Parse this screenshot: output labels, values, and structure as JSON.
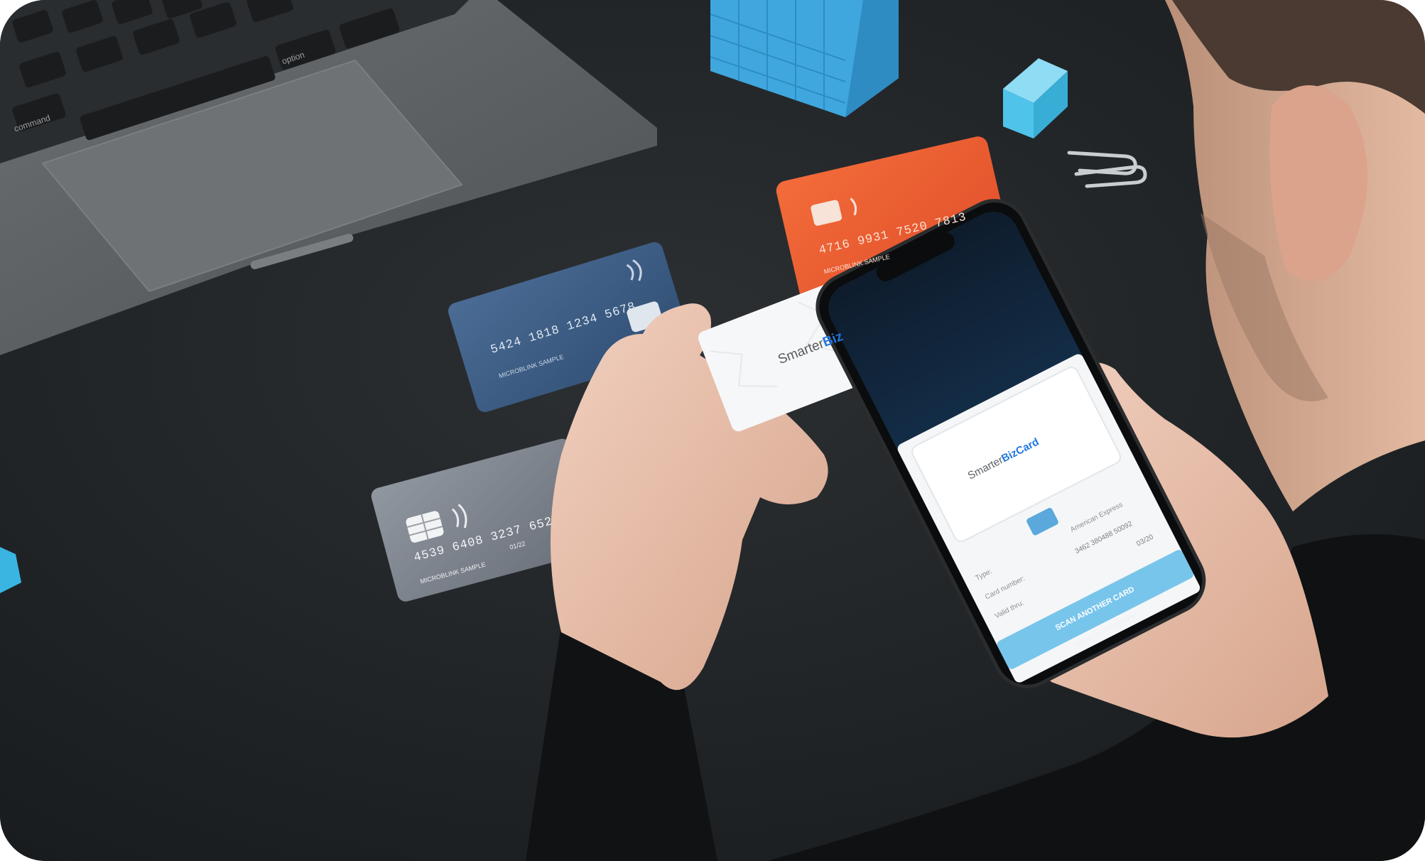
{
  "scene": {
    "colors": {
      "desk": "#202427",
      "laptop": "#5c6063",
      "orange_card": "#f05f33",
      "blue_card": "#3f5f86",
      "grey_card": "#7e848c",
      "accent_blue": "#1f77e0",
      "button_blue": "#78c5ec",
      "cube": "#4fc3ea"
    },
    "laptop": {
      "keys_row": [
        "command",
        "option"
      ]
    },
    "orange_card": {
      "number": "4716 9931 7520 7813",
      "caption": "MICROBLINK SAMPLE"
    },
    "blue_card": {
      "number": "5424 1818 1234 5678",
      "caption": "MICROBLINK SAMPLE"
    },
    "grey_card": {
      "number": "4539 6408 3237 652",
      "expiry": "01/22",
      "caption": "MICROBLINK SAMPLE"
    },
    "held_card": {
      "brand_plain": "Smarter",
      "brand_accent": "Biz"
    },
    "phone": {
      "card_brand_plain": "Smarter",
      "card_brand_accent": "BizCard",
      "result": {
        "type_label": "Type:",
        "type_value": "American Express",
        "number_label": "Card number:",
        "number_value": "3462 380488 50092",
        "valid_label": "Valid thru:",
        "valid_value": "03/20"
      },
      "button_label": "SCAN ANOTHER CARD"
    }
  }
}
